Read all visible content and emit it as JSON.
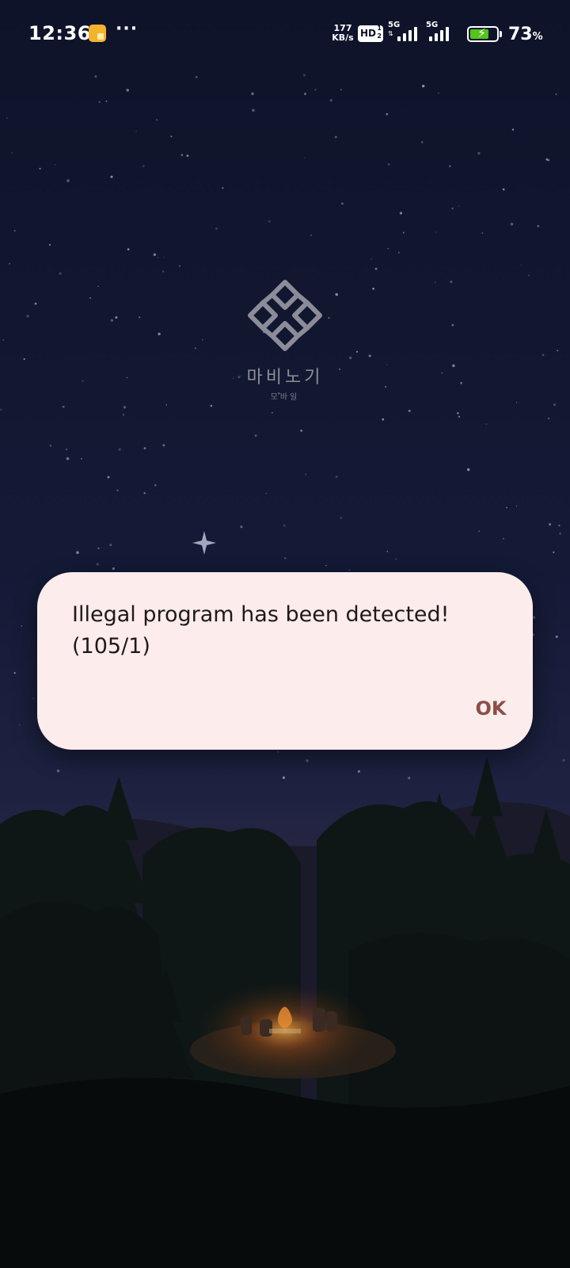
{
  "status_bar": {
    "time": "12:36",
    "more": "···",
    "net_speed_value": "177",
    "net_speed_unit": "KB/s",
    "hd_label": "HD",
    "hd_sup": "1",
    "hd_sub": "2",
    "sim1_type": "5G",
    "sim2_type": "5G",
    "battery_level": 73,
    "battery_text": "73",
    "battery_unit": "%",
    "battery_color": "#52c41a"
  },
  "app": {
    "logo_title": "마비노기",
    "logo_subtitle": "모바일"
  },
  "dialog": {
    "message_line1": "Illegal program has been detected!",
    "message_line2": "(105/1)",
    "ok_label": "OK",
    "background_color": "#fdecec",
    "accent_color": "#8b4f47"
  }
}
